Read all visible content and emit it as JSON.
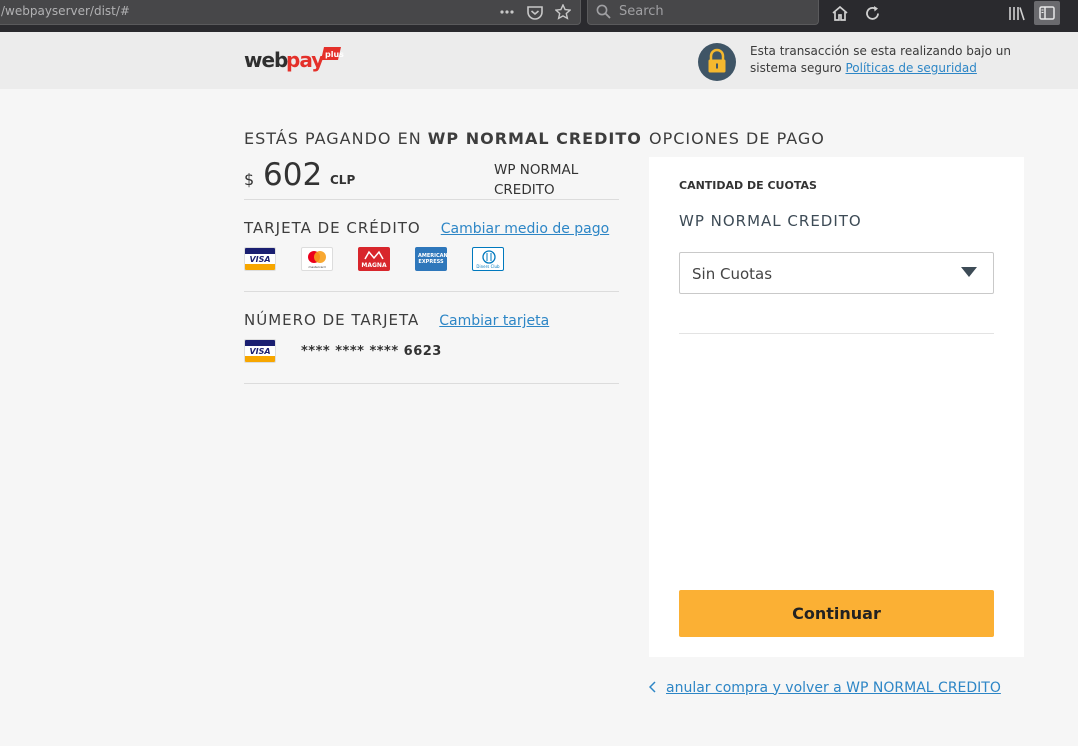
{
  "browser": {
    "url": "/webpayserver/dist/#",
    "search_placeholder": "Search"
  },
  "header": {
    "logo_text": "webpay",
    "logo_plus": "plus",
    "security_msg": "Esta transacción se esta realizando bajo un sistema seguro",
    "security_link": "Políticas de seguridad"
  },
  "payment": {
    "title_prefix": "ESTÁS PAGANDO EN",
    "merchant": "WP NORMAL CREDITO",
    "currency_symbol": "$",
    "amount": "602",
    "currency": "CLP",
    "merchant_name": "WP NORMAL CREDITO"
  },
  "card_section": {
    "label": "TARJETA DE CRÉDITO",
    "change_link": "Cambiar medio de pago",
    "cards": [
      "VISA",
      "mastercard",
      "MAGNA",
      "AMERICAN EXPRESS",
      "Diners Club"
    ]
  },
  "number_section": {
    "label": "NÚMERO DE TARJETA",
    "change_link": "Cambiar tarjeta",
    "card_brand": "VISA",
    "masked_number": "**** **** **** 6623"
  },
  "options": {
    "title": "OPCIONES DE PAGO",
    "cuotas_label": "CANTIDAD DE CUOTAS",
    "merchant": "WP NORMAL CREDITO",
    "selected_option": "Sin Cuotas",
    "continue_label": "Continuar",
    "cancel_link": "anular compra y volver a WP NORMAL CREDITO"
  },
  "colors": {
    "accent_button": "#fbb034",
    "link": "#2d86c6",
    "lock_bg": "#3f5566",
    "lock_fg": "#f5b82e",
    "webpay_red": "#e4302a"
  }
}
